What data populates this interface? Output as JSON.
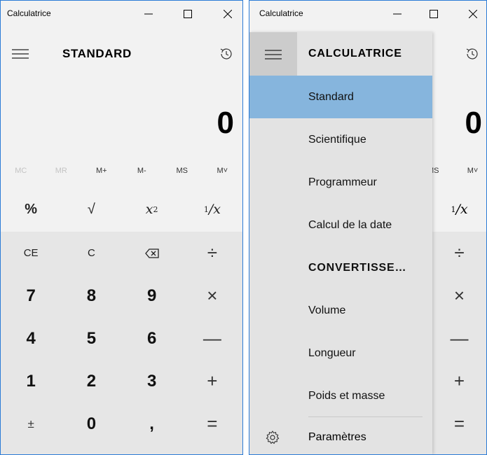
{
  "left_window": {
    "title": "Calculatrice",
    "mode": "STANDARD",
    "display_value": "0",
    "memory": [
      {
        "label": "MC",
        "enabled": false
      },
      {
        "label": "MR",
        "enabled": false
      },
      {
        "label": "M+",
        "enabled": true
      },
      {
        "label": "M-",
        "enabled": true
      },
      {
        "label": "MS",
        "enabled": true
      },
      {
        "label": "M˅",
        "enabled": true
      }
    ],
    "keys": {
      "percent": "%",
      "sqrt": "√",
      "square_base": "x",
      "square_exp": "2",
      "recip_num": "1",
      "recip_den": "/x",
      "ce": "CE",
      "c": "C",
      "divide": "÷",
      "multiply": "×",
      "minus": "—",
      "plus": "+",
      "equals": "=",
      "sign": "±",
      "comma": ",",
      "d7": "7",
      "d8": "8",
      "d9": "9",
      "d4": "4",
      "d5": "5",
      "d6": "6",
      "d1": "1",
      "d2": "2",
      "d3": "3",
      "d0": "0"
    }
  },
  "right_window": {
    "title": "Calculatrice",
    "display_value": "0",
    "memory_visible": [
      "MS",
      "M˅"
    ],
    "keys_visible": {
      "recip_num": "1",
      "recip_den": "/x",
      "divide": "÷",
      "multiply": "×",
      "minus": "—",
      "plus": "+",
      "equals": "="
    },
    "nav": {
      "header": "CALCULATRICE",
      "items": [
        {
          "label": "Standard",
          "selected": true
        },
        {
          "label": "Scientifique"
        },
        {
          "label": "Programmeur"
        },
        {
          "label": "Calcul de la date"
        }
      ],
      "section": "CONVERTISSE…",
      "converter_items": [
        {
          "label": "Volume"
        },
        {
          "label": "Longueur"
        },
        {
          "label": "Poids et masse"
        }
      ],
      "settings_label": "Paramètres"
    }
  },
  "icons": {
    "minimize": "minimize-icon",
    "maximize": "maximize-icon",
    "close": "close-icon",
    "hamburger": "hamburger-menu-icon",
    "history": "history-icon",
    "backspace": "backspace-icon",
    "settings": "gear-icon"
  },
  "colors": {
    "accent_border": "#2b7bd6",
    "selected_nav": "#86b5dd",
    "key_bg": "#e6e6e6",
    "window_bg": "#f2f2f2"
  }
}
